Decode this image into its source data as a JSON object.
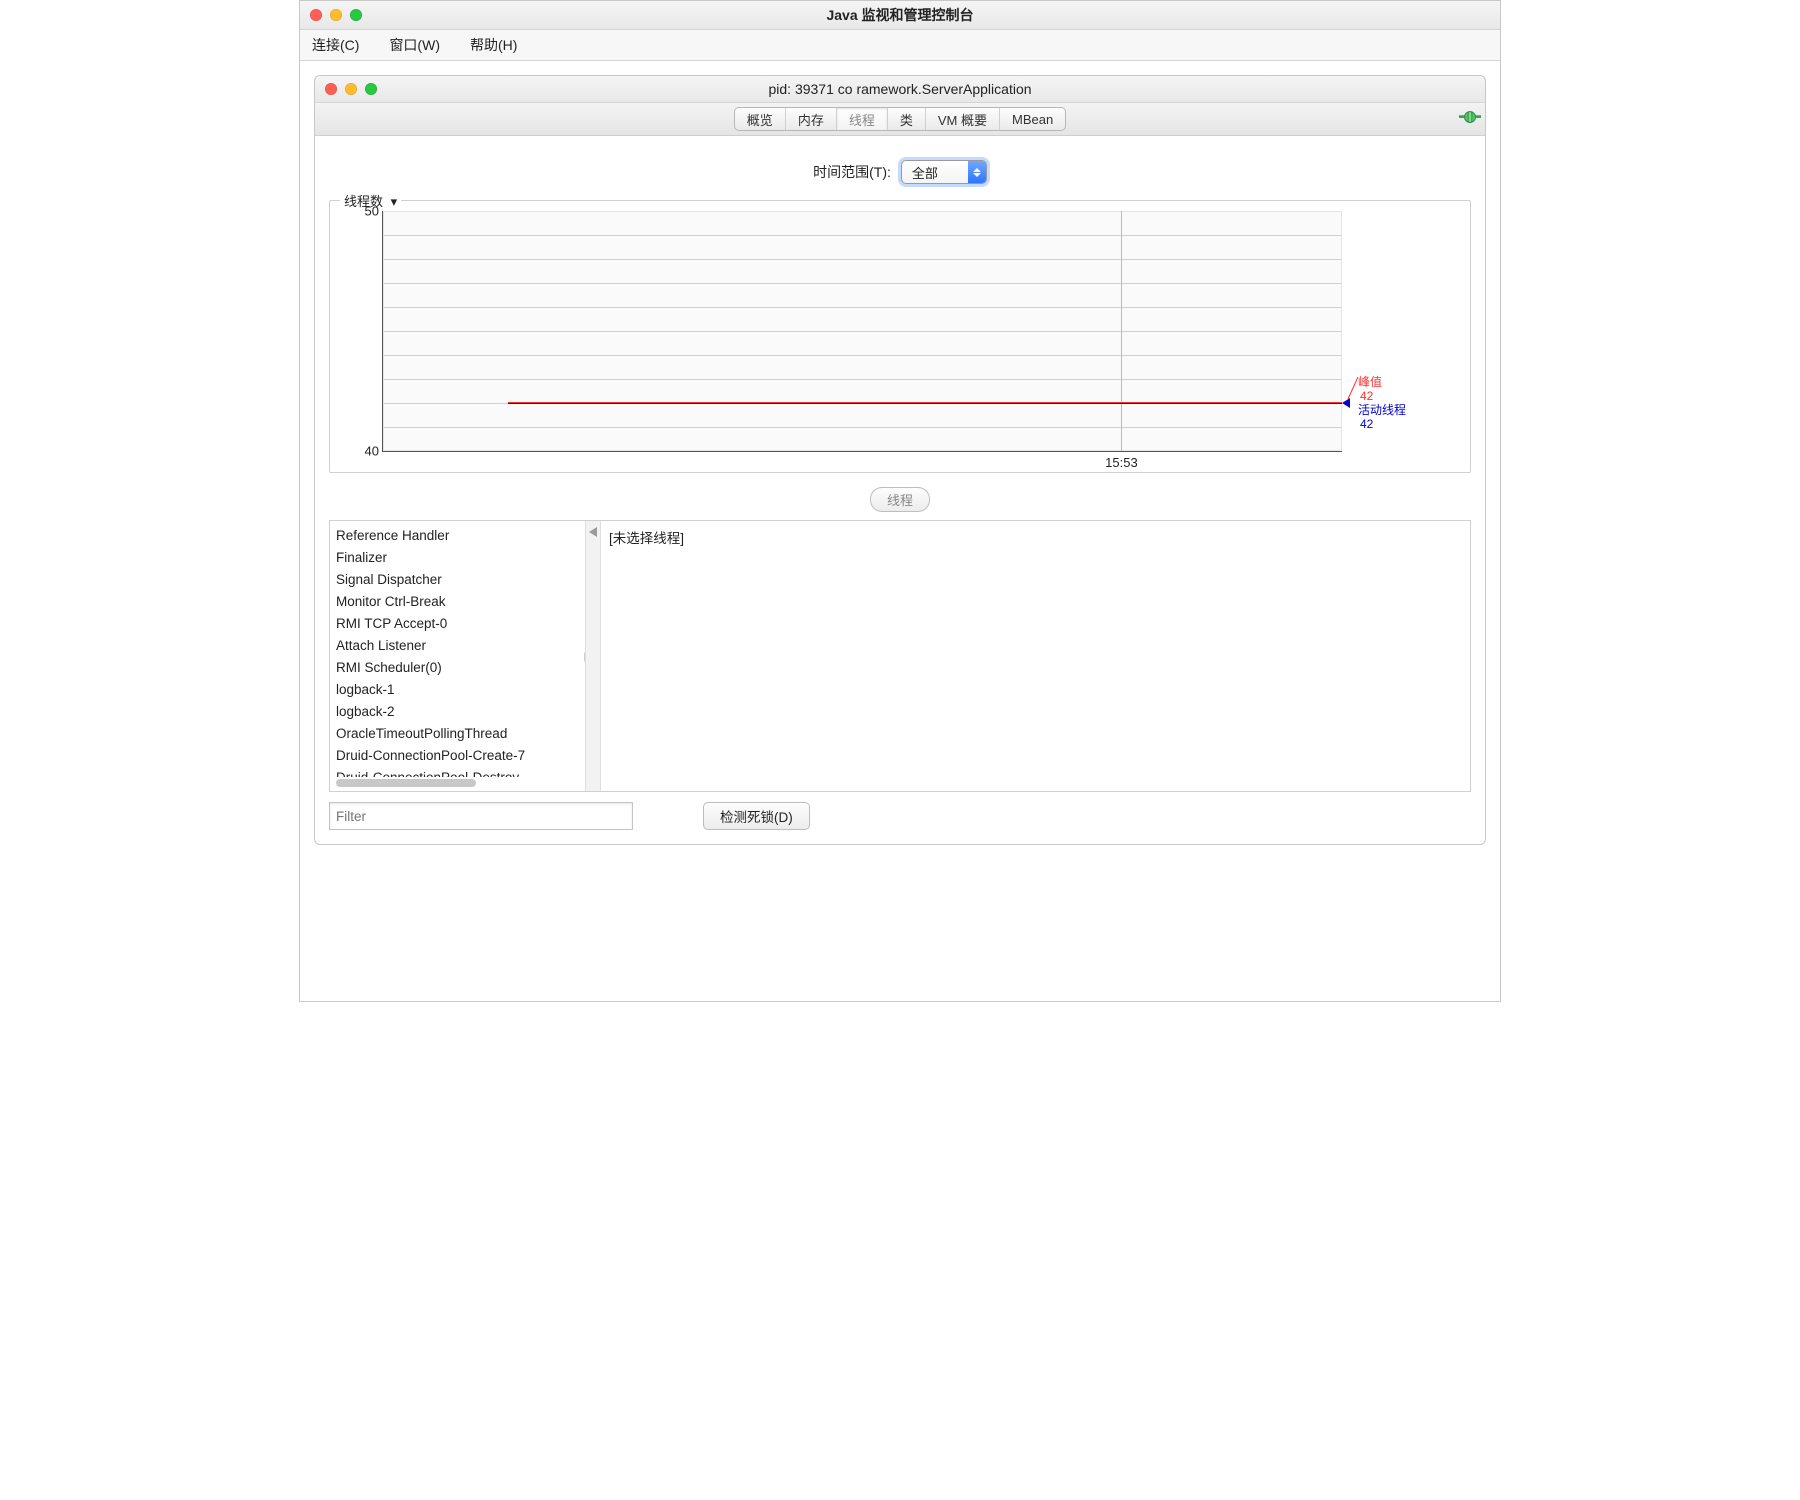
{
  "window_title": "Java 监视和管理控制台",
  "menubar": [
    "连接(C)",
    "窗口(W)",
    "帮助(H)"
  ],
  "inner_title": "pid: 39371 co        ramework.ServerApplication",
  "tabs": [
    "概览",
    "内存",
    "线程",
    "类",
    "VM 概要",
    "MBean"
  ],
  "active_tab": "线程",
  "time_range_label": "时间范围(T):",
  "time_range_value": "全部",
  "chart_title": "线程数",
  "chart_legend": {
    "peak_name": "峰值",
    "peak_value": "42",
    "active_name": "活动线程",
    "active_value": "42"
  },
  "chart_data": {
    "type": "line",
    "title": "线程数",
    "xlabel": "",
    "ylabel": "",
    "ylim": [
      40,
      50
    ],
    "y_ticks": [
      40,
      50
    ],
    "x_ticks": [
      "15:53"
    ],
    "series": [
      {
        "name": "活动线程",
        "color": "#0000d0",
        "value": 42
      },
      {
        "name": "峰值",
        "color": "#ff3030",
        "value": 42
      }
    ],
    "x_major_position_pct": 77
  },
  "divider_button": "线程",
  "threads": [
    "Reference Handler",
    "Finalizer",
    "Signal Dispatcher",
    "Monitor Ctrl-Break",
    "RMI TCP Accept-0",
    "Attach Listener",
    "RMI Scheduler(0)",
    "logback-1",
    "logback-2",
    "OracleTimeoutPollingThread",
    "Druid-ConnectionPool-Create-7",
    "Druid-ConnectionPool-Destroy-"
  ],
  "detail_placeholder": "[未选择线程]",
  "filter_placeholder": "Filter",
  "deadlock_btn": "检测死锁(D)"
}
